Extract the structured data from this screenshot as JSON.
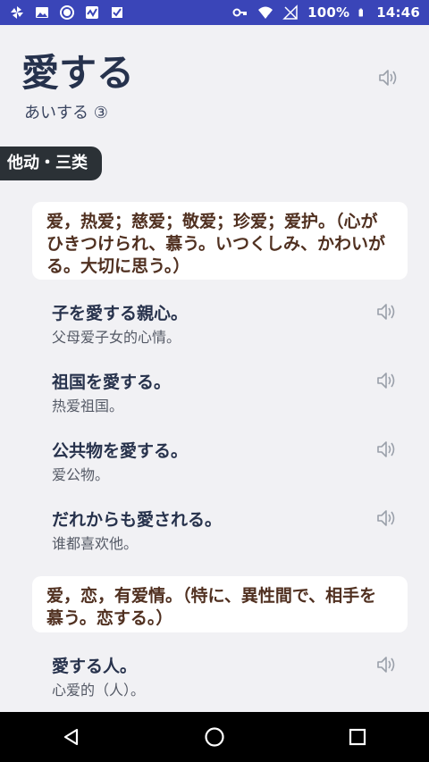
{
  "status": {
    "battery": "100%",
    "time": "14:46"
  },
  "entry": {
    "word": "愛する",
    "reading": "あいする ③",
    "pos": "他动・三类"
  },
  "senses": [
    {
      "meaning": "爱，热爱；慈爱；敬爱；珍爱；爱护。（心がひきつけられ、慕う。いつくしみ、かわいがる。大切に思う。）",
      "examples": [
        {
          "jp": "子を愛する親心。",
          "zh": "父母爱子女的心情。"
        },
        {
          "jp": "祖国を愛する。",
          "zh": "热爱祖国。"
        },
        {
          "jp": "公共物を愛する。",
          "zh": "爱公物。"
        },
        {
          "jp": "だれからも愛される。",
          "zh": "谁都喜欢他。"
        }
      ]
    },
    {
      "meaning": "爱，恋，有爱情。（特に、異性間で、相手を慕う。恋する。）",
      "examples": [
        {
          "jp": "愛する人。",
          "zh": "心爱的（人）。"
        }
      ]
    }
  ]
}
